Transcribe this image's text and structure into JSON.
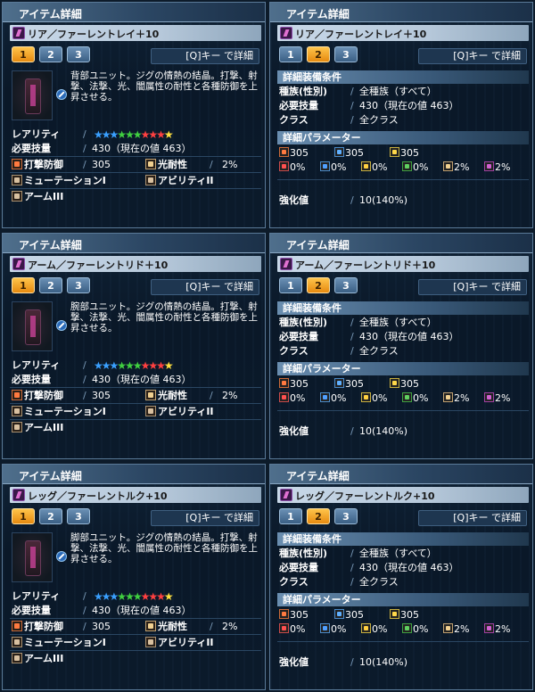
{
  "panel_title": "アイテム詳細",
  "qkey_label": "[Q]キー で詳細",
  "tabs": [
    "1",
    "2",
    "3"
  ],
  "colors": {
    "tab_active": "#f0a020",
    "star_colors": [
      "#3aa0ff",
      "#3aa0ff",
      "#3aa0ff",
      "#40d040",
      "#40d040",
      "#40d040",
      "#ff4040",
      "#ff4040",
      "#ff4040",
      "#ffe040"
    ]
  },
  "items": [
    {
      "name": "リア／ファーレントレイ＋10",
      "description": "背部ユニット。ジグの情熱の結晶。打撃、射撃、法撃、光、闇属性の耐性と各種防御を上昇させる。",
      "rarity_label": "レアリティ",
      "stars": [
        "★",
        "★",
        "★",
        "★",
        "★",
        "★",
        "★",
        "★",
        "★",
        "★"
      ],
      "req_label": "必要技量",
      "req_value": "430（現在の値 463）",
      "def_label": "打撃防御",
      "def_value": "305",
      "light_label": "光耐性",
      "light_value": "2%",
      "slot1": "ミューテーションI",
      "slot2": "アビリティII",
      "slot3": "アームIII",
      "detail": {
        "equip_cond": "詳細装備条件",
        "race_label": "種族(性別)",
        "race_value": "全種族（すべて）",
        "req_label": "必要技量",
        "req_value": "430（現在の値 463）",
        "class_label": "クラス",
        "class_value": "全クラス",
        "params_label": "詳細パラメーター",
        "def_values": [
          "305",
          "305",
          "305"
        ],
        "res_values": [
          "0%",
          "0%",
          "0%",
          "0%",
          "2%",
          "2%"
        ],
        "enhance_label": "強化値",
        "enhance_value": "10(140%)"
      }
    },
    {
      "name": "アーム／ファーレントリド＋10",
      "description": "腕部ユニット。ジグの情熱の結晶。打撃、射撃、法撃、光、闇属性の耐性と各種防御を上昇させる。",
      "rarity_label": "レアリティ",
      "stars": [
        "★",
        "★",
        "★",
        "★",
        "★",
        "★",
        "★",
        "★",
        "★",
        "★"
      ],
      "req_label": "必要技量",
      "req_value": "430（現在の値 463）",
      "def_label": "打撃防御",
      "def_value": "305",
      "light_label": "光耐性",
      "light_value": "2%",
      "slot1": "ミューテーションI",
      "slot2": "アビリティII",
      "slot3": "アームIII",
      "detail": {
        "equip_cond": "詳細装備条件",
        "race_label": "種族(性別)",
        "race_value": "全種族（すべて）",
        "req_label": "必要技量",
        "req_value": "430（現在の値 463）",
        "class_label": "クラス",
        "class_value": "全クラス",
        "params_label": "詳細パラメーター",
        "def_values": [
          "305",
          "305",
          "305"
        ],
        "res_values": [
          "0%",
          "0%",
          "0%",
          "0%",
          "2%",
          "2%"
        ],
        "enhance_label": "強化値",
        "enhance_value": "10(140%)"
      }
    },
    {
      "name": "レッグ／ファーレントルク+10",
      "description": "脚部ユニット。ジグの情熱の結晶。打撃、射撃、法撃、光、闇属性の耐性と各種防御を上昇させる。",
      "rarity_label": "レアリティ",
      "stars": [
        "★",
        "★",
        "★",
        "★",
        "★",
        "★",
        "★",
        "★",
        "★",
        "★"
      ],
      "req_label": "必要技量",
      "req_value": "430（現在の値 463）",
      "def_label": "打撃防御",
      "def_value": "305",
      "light_label": "光耐性",
      "light_value": "2%",
      "slot1": "ミューテーションI",
      "slot2": "アビリティII",
      "slot3": "アームIII",
      "detail": {
        "equip_cond": "詳細装備条件",
        "race_label": "種族(性別)",
        "race_value": "全種族（すべて）",
        "req_label": "必要技量",
        "req_value": "430（現在の値 463）",
        "class_label": "クラス",
        "class_value": "全クラス",
        "params_label": "詳細パラメーター",
        "def_values": [
          "305",
          "305",
          "305"
        ],
        "res_values": [
          "0%",
          "0%",
          "0%",
          "0%",
          "2%",
          "2%"
        ],
        "enhance_label": "強化値",
        "enhance_value": "10(140%)"
      }
    }
  ]
}
